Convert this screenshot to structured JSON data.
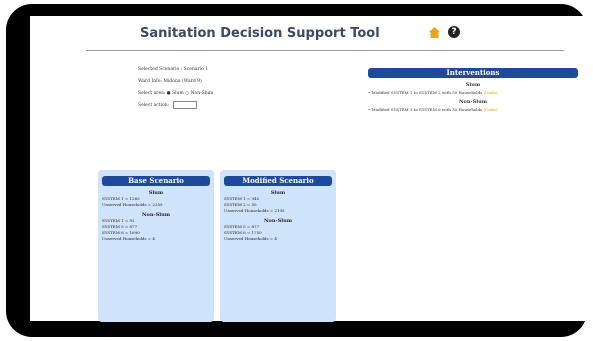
{
  "header": {
    "title": "Sanitation Decision Support Tool"
  },
  "settings": {
    "scenario": "Selected Scenario : Scenario 1",
    "ward": "Ward Info: Midona (Ward 9)",
    "area": "Select area: ● Slum ○ Non-Slum",
    "action_label": "Select action:"
  },
  "interventions": {
    "title": "Interventions",
    "slum_heading": "Slum",
    "slum_item": "• Modified SYSTEM 1 to SYSTEM 2 with 50 Households",
    "slum_link": "(Undo)",
    "nonslum_heading": "Non-Slum",
    "nonslum_item": "• Modified SYSTEM 1 to SYSTEM 6 with 30 Households",
    "nonslum_link": "(Undo)"
  },
  "base": {
    "title": "Base Scenario",
    "slum_heading": "Slum",
    "slum_lines": [
      "SYSTEM 1 = 1265",
      "Unserved Households = 2255"
    ],
    "nonslum_heading": "Non-Slum",
    "nonslum_lines": [
      "SYSTEM 1 = 92",
      "SYSTEM 5 = 877",
      "SYSTEM 6 = 1690",
      "Unserved Households = 4"
    ]
  },
  "modified": {
    "title": "Modified Scenario",
    "slum_heading": "Slum",
    "slum_lines": [
      "SYSTEM 1 = 945",
      "SYSTEM 2 = 50",
      "Unserved Households = 2195"
    ],
    "nonslum_heading": "Non-Slum",
    "nonslum_lines": [
      "SYSTEM 5 = 877",
      "SYSTEM 6 = 1750",
      "Unserved Households = 4"
    ]
  },
  "colors": {
    "accent": "#1f4a9c",
    "card": "#cfe3fb",
    "link": "#e0a000",
    "frame": "#000000"
  }
}
